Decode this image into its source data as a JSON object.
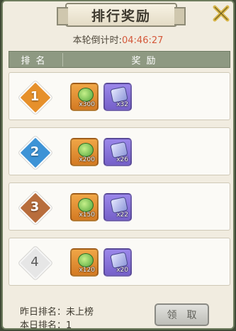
{
  "title": "排行奖励",
  "countdown": {
    "label": "本轮倒计时:",
    "time": "04:46:27"
  },
  "table": {
    "col_rank": "排名",
    "col_reward": "奖励"
  },
  "rows": [
    {
      "rank": "1",
      "rewards": [
        {
          "icon": "green-gem-item-icon",
          "qty": "x300"
        },
        {
          "icon": "purple-crystal-item-icon",
          "qty": "x32"
        }
      ]
    },
    {
      "rank": "2",
      "rewards": [
        {
          "icon": "green-gem-item-icon",
          "qty": "x200"
        },
        {
          "icon": "purple-crystal-item-icon",
          "qty": "x26"
        }
      ]
    },
    {
      "rank": "3",
      "rewards": [
        {
          "icon": "green-gem-item-icon",
          "qty": "x150"
        },
        {
          "icon": "purple-crystal-item-icon",
          "qty": "x22"
        }
      ]
    },
    {
      "rank": "4",
      "rewards": [
        {
          "icon": "green-gem-item-icon",
          "qty": "x120"
        },
        {
          "icon": "purple-crystal-item-icon",
          "qty": "x20"
        }
      ]
    }
  ],
  "footer": {
    "yesterday": "昨日排名：未上榜",
    "today": "本日排名：1"
  },
  "claim_button": "领取",
  "colors": {
    "countdown_time": "#d4583a",
    "header_bg": "#8e9982"
  }
}
